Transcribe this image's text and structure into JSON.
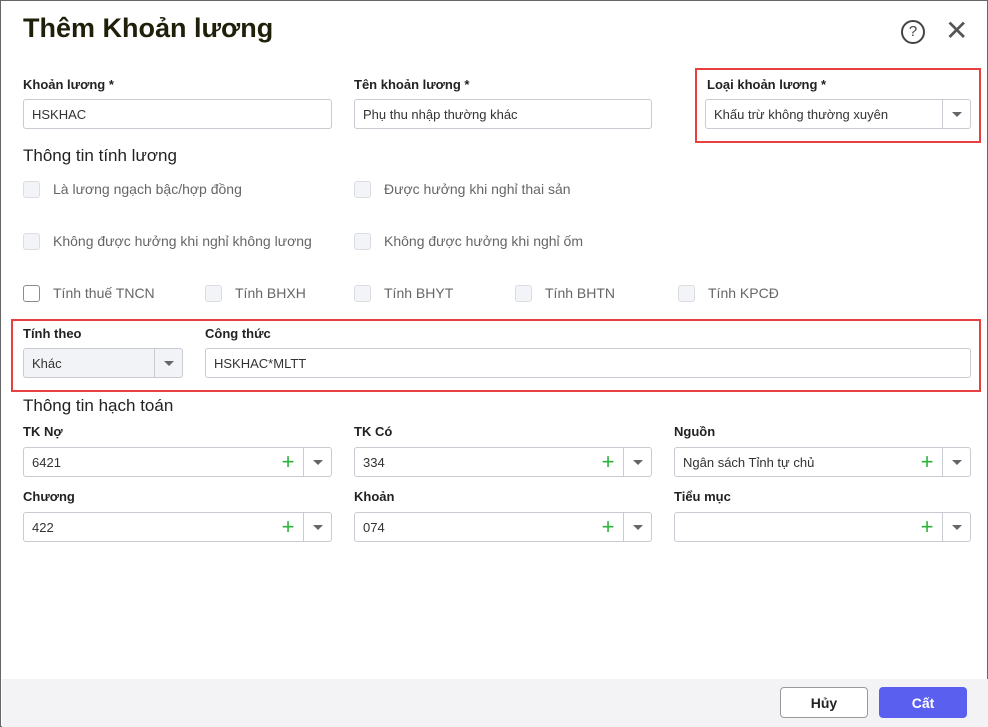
{
  "dialog": {
    "title": "Thêm Khoản lương",
    "help_icon": "help-icon",
    "close_icon": "close-icon"
  },
  "fields": {
    "khoan_luong": {
      "label": "Khoản lương *",
      "value": "HSKHAC"
    },
    "ten_khoan_luong": {
      "label": "Tên khoản lương *",
      "value": "Phụ thu nhập thường khác"
    },
    "loai_khoan_luong": {
      "label": "Loại khoản lương *",
      "value": "Khấu trừ không thường xuyên"
    }
  },
  "tinh_luong": {
    "title": "Thông tin tính lương",
    "checkboxes": [
      {
        "label": "Là lương ngạch bậc/hợp đồng",
        "checked": false,
        "enabled": false
      },
      {
        "label": "Được hưởng khi nghỉ thai sản",
        "checked": false,
        "enabled": false
      },
      {
        "label": "Không được hưởng khi nghỉ không lương",
        "checked": false,
        "enabled": false
      },
      {
        "label": "Không được hưởng khi nghỉ ốm",
        "checked": false,
        "enabled": false
      },
      {
        "label": "Tính thuế TNCN",
        "checked": false,
        "enabled": true
      },
      {
        "label": "Tính BHXH",
        "checked": false,
        "enabled": false
      },
      {
        "label": "Tính BHYT",
        "checked": false,
        "enabled": false
      },
      {
        "label": "Tính BHTN",
        "checked": false,
        "enabled": false
      },
      {
        "label": "Tính KPCĐ",
        "checked": false,
        "enabled": false
      }
    ],
    "tinh_theo": {
      "label": "Tính theo",
      "value": "Khác"
    },
    "cong_thuc": {
      "label": "Công thức",
      "value": "HSKHAC*MLTT"
    }
  },
  "hach_toan": {
    "title": "Thông tin hạch toán",
    "fields": [
      {
        "label": "TK Nợ",
        "value": "6421"
      },
      {
        "label": "TK Có",
        "value": "334"
      },
      {
        "label": "Nguồn",
        "value": "Ngân sách Tỉnh tự chủ"
      },
      {
        "label": "Chương",
        "value": "422"
      },
      {
        "label": "Khoản",
        "value": "074"
      },
      {
        "label": "Tiểu mục",
        "value": ""
      }
    ]
  },
  "footer": {
    "cancel": "Hủy",
    "save": "Cất"
  },
  "colors": {
    "primary": "#5b5fef",
    "highlight": "#e8403f",
    "plus": "#2bb33c"
  }
}
